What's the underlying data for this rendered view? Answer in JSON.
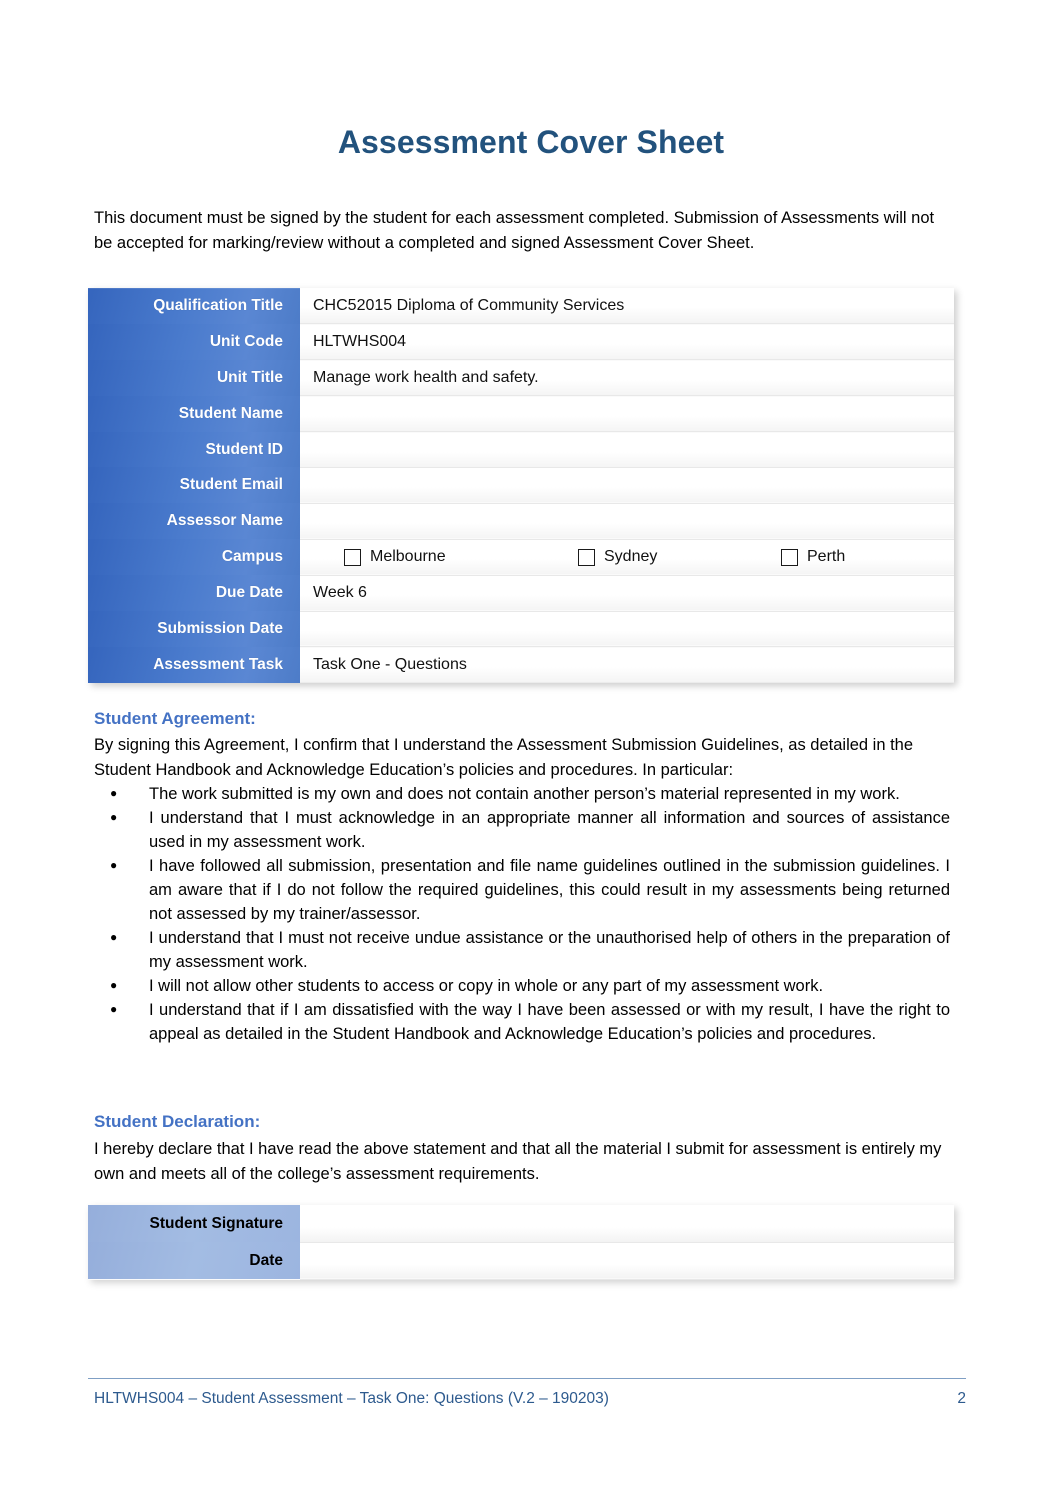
{
  "document": {
    "title": "Assessment Cover Sheet",
    "intro": "This document must be signed by the student for each assessment completed. Submission of Assessments will not be accepted for marking/review without a completed and signed Assessment Cover Sheet."
  },
  "info_table": {
    "rows": [
      {
        "label": "Qualification Title",
        "value": "CHC52015 Diploma of Community Services"
      },
      {
        "label": "Unit Code",
        "value": "HLTWHS004"
      },
      {
        "label": "Unit Title",
        "value": "Manage work health and safety."
      },
      {
        "label": "Student Name",
        "value": ""
      },
      {
        "label": "Student ID",
        "value": ""
      },
      {
        "label": "Student Email",
        "value": ""
      },
      {
        "label": "Assessor Name",
        "value": ""
      },
      {
        "label": "Campus",
        "value": ""
      },
      {
        "label": "Due Date",
        "value": "Week 6"
      },
      {
        "label": "Submission Date",
        "value": ""
      },
      {
        "label": "Assessment Task",
        "value": "Task One - Questions"
      }
    ],
    "campus_options": [
      {
        "label": "Melbourne",
        "checked": false
      },
      {
        "label": "Sydney",
        "checked": false
      },
      {
        "label": "Perth",
        "checked": false
      }
    ]
  },
  "agreement": {
    "heading": "Student Agreement:",
    "intro": "By signing this Agreement, I confirm that I understand the Assessment Submission Guidelines, as detailed in the Student Handbook and Acknowledge Education’s policies and procedures. In particular:",
    "bullets": [
      "The work submitted is my own and does not contain another person’s material represented in my work.",
      "I understand that I must acknowledge in an appropriate manner all information and sources of assistance used in my assessment work.",
      "I have followed all submission, presentation and file name guidelines outlined in the submission guidelines. I am aware that if I do not follow the required guidelines, this could result in my assessments being returned not assessed by my trainer/assessor.",
      "I understand that I must not receive undue assistance or the unauthorised help of others in the preparation of my assessment work.",
      "I will not allow other students to access or copy in whole or any part of my assessment work.",
      "I understand that if I am dissatisfied with the way I have been assessed or with my result, I have the right to appeal as detailed in the Student Handbook and Acknowledge Education’s policies and procedures."
    ]
  },
  "declaration": {
    "heading": "Student Declaration:",
    "body": "I hereby declare that I have read the above statement and that all the material I submit for assessment is entirely my own and meets all of the college’s assessment requirements."
  },
  "signature_table": {
    "rows": [
      {
        "label": "Student Signature",
        "value": ""
      },
      {
        "label": "Date",
        "value": ""
      }
    ]
  },
  "footer": {
    "text": "HLTWHS004 – Student Assessment – Task One: Questions (V.2 – 190203)",
    "page_number": "2"
  },
  "colors": {
    "title_blue": "#22527d",
    "heading_blue": "#4472c4",
    "table_header_blue": "#4a7bcd",
    "signature_header_blue": "#a3bce3",
    "footer_blue": "#2d5a8e"
  }
}
